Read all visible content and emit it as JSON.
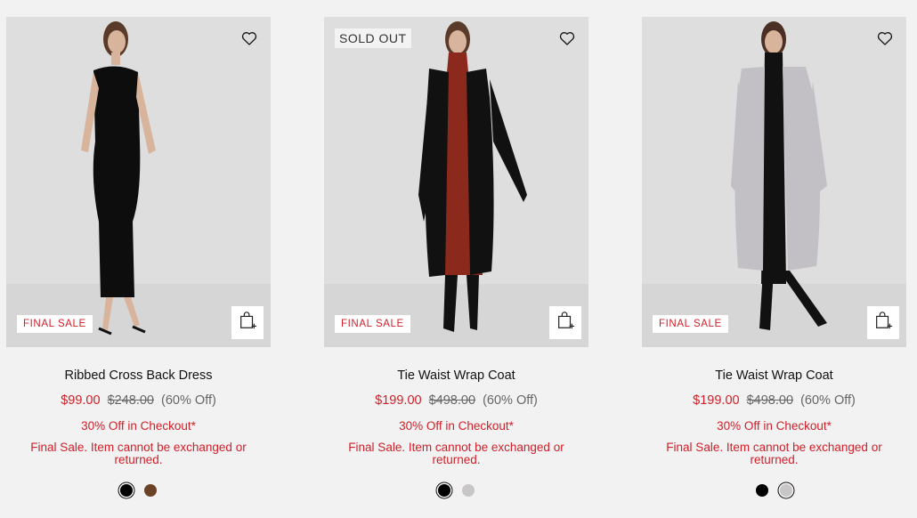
{
  "products": [
    {
      "name": "Ribbed Cross Back Dress",
      "sale_price": "$99.00",
      "original_price": "$248.00",
      "discount": "(60% Off)",
      "promo": "30% Off in Checkout*",
      "final_note": "Final Sale. Item cannot be exchanged or returned.",
      "badge": "FINAL SALE",
      "soldout": "",
      "swatches": [
        {
          "color": "#000000",
          "selected": true
        },
        {
          "color": "#6b4226",
          "selected": false
        }
      ]
    },
    {
      "name": "Tie Waist Wrap Coat",
      "sale_price": "$199.00",
      "original_price": "$498.00",
      "discount": "(60% Off)",
      "promo": "30% Off in Checkout*",
      "final_note": "Final Sale. Item cannot be exchanged or returned.",
      "badge": "FINAL SALE",
      "soldout": "SOLD OUT",
      "swatches": [
        {
          "color": "#000000",
          "selected": true
        },
        {
          "color": "#c9c6c8",
          "selected": false
        }
      ]
    },
    {
      "name": "Tie Waist Wrap Coat",
      "sale_price": "$199.00",
      "original_price": "$498.00",
      "discount": "(60% Off)",
      "promo": "30% Off in Checkout*",
      "final_note": "Final Sale. Item cannot be exchanged or returned.",
      "badge": "FINAL SALE",
      "soldout": "",
      "swatches": [
        {
          "color": "#000000",
          "selected": false
        },
        {
          "color": "#c9c6c8",
          "selected": true
        }
      ]
    }
  ],
  "icons": {
    "wishlist": "heart-outline-icon",
    "quick_add": "shopping-bag-plus-icon"
  },
  "colors": {
    "sale_red": "#d0202a",
    "background": "#f2f2f2"
  }
}
